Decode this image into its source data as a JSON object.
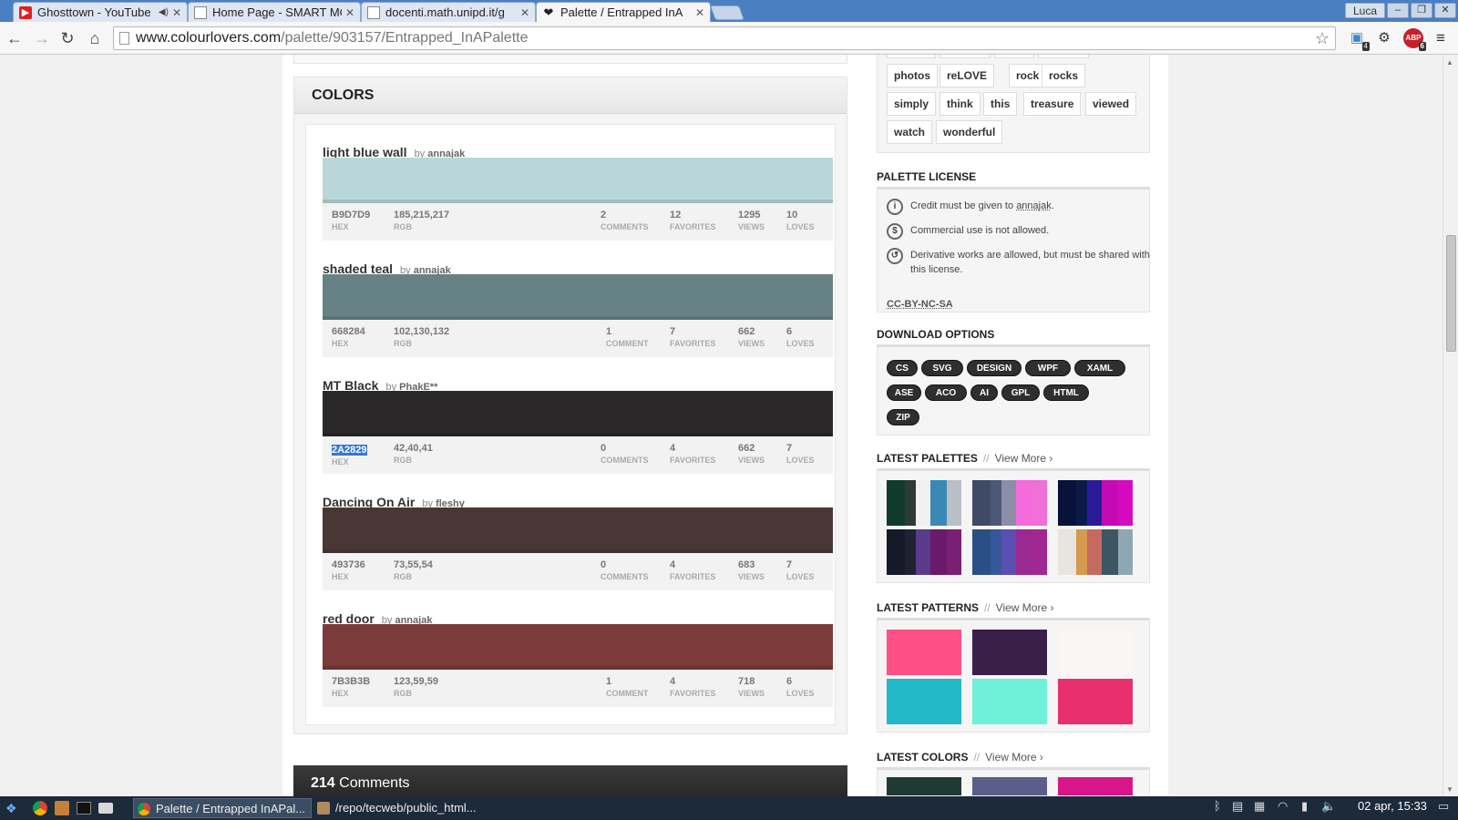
{
  "browser": {
    "tabs": [
      {
        "title": "Ghosttown - YouTube",
        "favicon": "youtube-icon"
      },
      {
        "title": "Home Page - SMART MO",
        "favicon": "page-icon"
      },
      {
        "title": "docenti.math.unipd.it/g",
        "favicon": "page-icon"
      },
      {
        "title": "Palette / Entrapped InA",
        "favicon": "heart-icon"
      }
    ],
    "user": "Luca",
    "url_host": "www.colourlovers.com",
    "url_path": "/palette/903157/Entrapped_InAPalette",
    "ext_badges": {
      "first": "4",
      "abp": "ABP",
      "abp_count": "6"
    }
  },
  "colors_section": {
    "title": "COLORS",
    "items": [
      {
        "name": "light blue wall",
        "by": "by",
        "author": "annajak",
        "color": "#B9D7D9",
        "hex": "B9D7D9",
        "rgb": "185,215,217",
        "comments": "2",
        "comments_label": "COMMENTS",
        "favorites": "12",
        "views": "1295",
        "loves": "10"
      },
      {
        "name": "shaded teal",
        "by": "by",
        "author": "annajak",
        "color": "#668284",
        "hex": "668284",
        "rgb": "102,130,132",
        "comments": "1",
        "comments_label": "COMMENT",
        "favorites": "7",
        "views": "662",
        "loves": "6"
      },
      {
        "name": "MT Black",
        "by": "by",
        "author": "PhakE**",
        "color": "#2A2829",
        "hex": "2A2829",
        "rgb": "42,40,41",
        "comments": "0",
        "comments_label": "COMMENTS",
        "favorites": "4",
        "views": "662",
        "loves": "7"
      },
      {
        "name": "Dancing On Air",
        "by": "by",
        "author": "fleshy",
        "color": "#493736",
        "hex": "493736",
        "rgb": "73,55,54",
        "comments": "0",
        "comments_label": "COMMENTS",
        "favorites": "4",
        "views": "683",
        "loves": "7"
      },
      {
        "name": "red door",
        "by": "by",
        "author": "annajak",
        "color": "#7B3B3B",
        "hex": "7B3B3B",
        "rgb": "123,59,59",
        "comments": "1",
        "comments_label": "COMMENT",
        "favorites": "4",
        "views": "718",
        "loves": "6"
      }
    ],
    "labels": {
      "hex": "HEX",
      "rgb": "RGB",
      "favorites": "FAVORITES",
      "views": "VIEWS",
      "loves": "LOVES"
    }
  },
  "comments": {
    "count": "214",
    "label": "Comments"
  },
  "tags": [
    "photos",
    "reLOVE",
    "rock",
    "rocks",
    "simply",
    "think",
    "this",
    "treasure",
    "viewed",
    "watch",
    "wonderful"
  ],
  "license": {
    "title": "PALETTE LICENSE",
    "credit_prefix": "Credit must be given to",
    "credit_author": "annajak",
    "credit_suffix": ".",
    "commercial": "Commercial use is not allowed.",
    "derivative": "Derivative works are allowed, but must be shared with this license.",
    "code": "CC-BY-NC-SA"
  },
  "download": {
    "title": "DOWNLOAD OPTIONS",
    "options": [
      "CS",
      "SVG",
      "DESIGN",
      "WPF",
      "XAML",
      "ASE",
      "ACO",
      "AI",
      "GPL",
      "HTML",
      "ZIP"
    ]
  },
  "latest_palettes": {
    "title": "LATEST PALETTES",
    "sep": "//",
    "more": "View More ›",
    "palettes": [
      [
        "#0f3a2c",
        "#2e3a36",
        "#f0f0f0",
        "#3a89b5",
        "#b9bfc4"
      ],
      [
        "#3e4a68",
        "#4d5878",
        "#8b8ea6",
        "#f46bdc",
        "#f06fd8"
      ],
      [
        "#08123a",
        "#0c1a4a",
        "#2a1a9a",
        "#c40ab4",
        "#d50ac0"
      ],
      [
        "#151a28",
        "#1e2233",
        "#5a3a8a",
        "#6a1a6a",
        "#7a1f74"
      ],
      [
        "#2a4e86",
        "#35589a",
        "#5a4eb0",
        "#9a2a92",
        "#a02890"
      ],
      [
        "#e8e4de",
        "#d69a4e",
        "#c46a5e",
        "#3e5566",
        "#8fa7b0"
      ]
    ]
  },
  "latest_patterns": {
    "title": "LATEST PATTERNS",
    "sep": "//",
    "more": "View More ›",
    "patterns": [
      "#ff4f86",
      "#3a1f4a",
      "#faf6f4",
      "#22b8c8",
      "#6ff0d8",
      "#e8306e"
    ]
  },
  "latest_colors": {
    "title": "LATEST COLORS",
    "sep": "//",
    "more": "View More ›"
  },
  "taskbar": {
    "task1": "Palette / Entrapped InAPal...",
    "task2": "/repo/tecweb/public_html...",
    "clock": "02 apr, 15:33"
  }
}
